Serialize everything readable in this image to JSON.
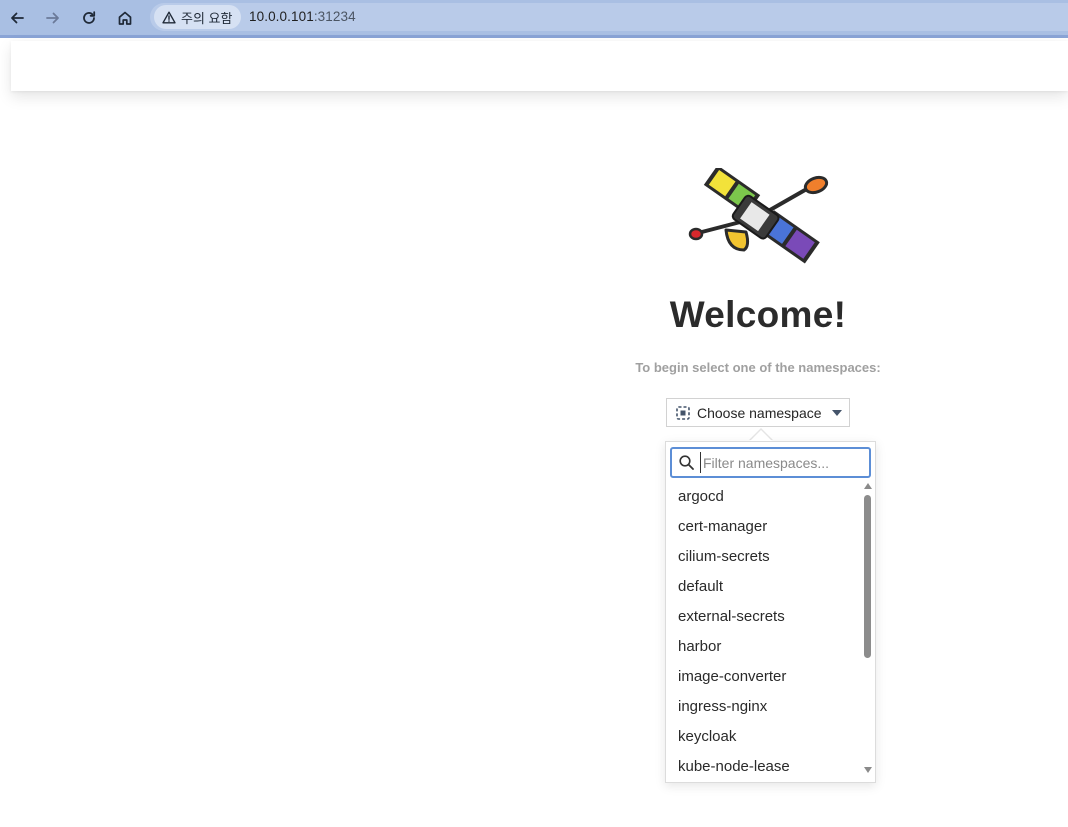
{
  "browser": {
    "back_icon": "arrow-left-icon",
    "forward_icon": "arrow-right-icon",
    "reload_icon": "reload-icon",
    "home_icon": "home-icon",
    "security_label": "주의 요함",
    "security_icon": "warning-triangle-icon",
    "url_host": "10.0.0.101",
    "url_port": ":31234"
  },
  "welcome": {
    "title": "Welcome!",
    "subtitle": "To begin select one of the namespaces:",
    "logo_icon": "satellite-logo"
  },
  "namespace_selector": {
    "button_label": "Choose namespace",
    "icon": "namespace-icon",
    "caret_icon": "caret-down-icon"
  },
  "dropdown": {
    "filter_placeholder": "Filter namespaces...",
    "search_icon": "search-icon",
    "items": [
      "argocd",
      "cert-manager",
      "cilium-secrets",
      "default",
      "external-secrets",
      "harbor",
      "image-converter",
      "ingress-nginx",
      "keycloak",
      "kube-node-lease"
    ]
  },
  "colors": {
    "browser_bar": "#a9bfe3",
    "filter_focus": "#5c8ed6",
    "title_text": "#2b2b2b",
    "subtitle_text": "#a0a0a0"
  }
}
